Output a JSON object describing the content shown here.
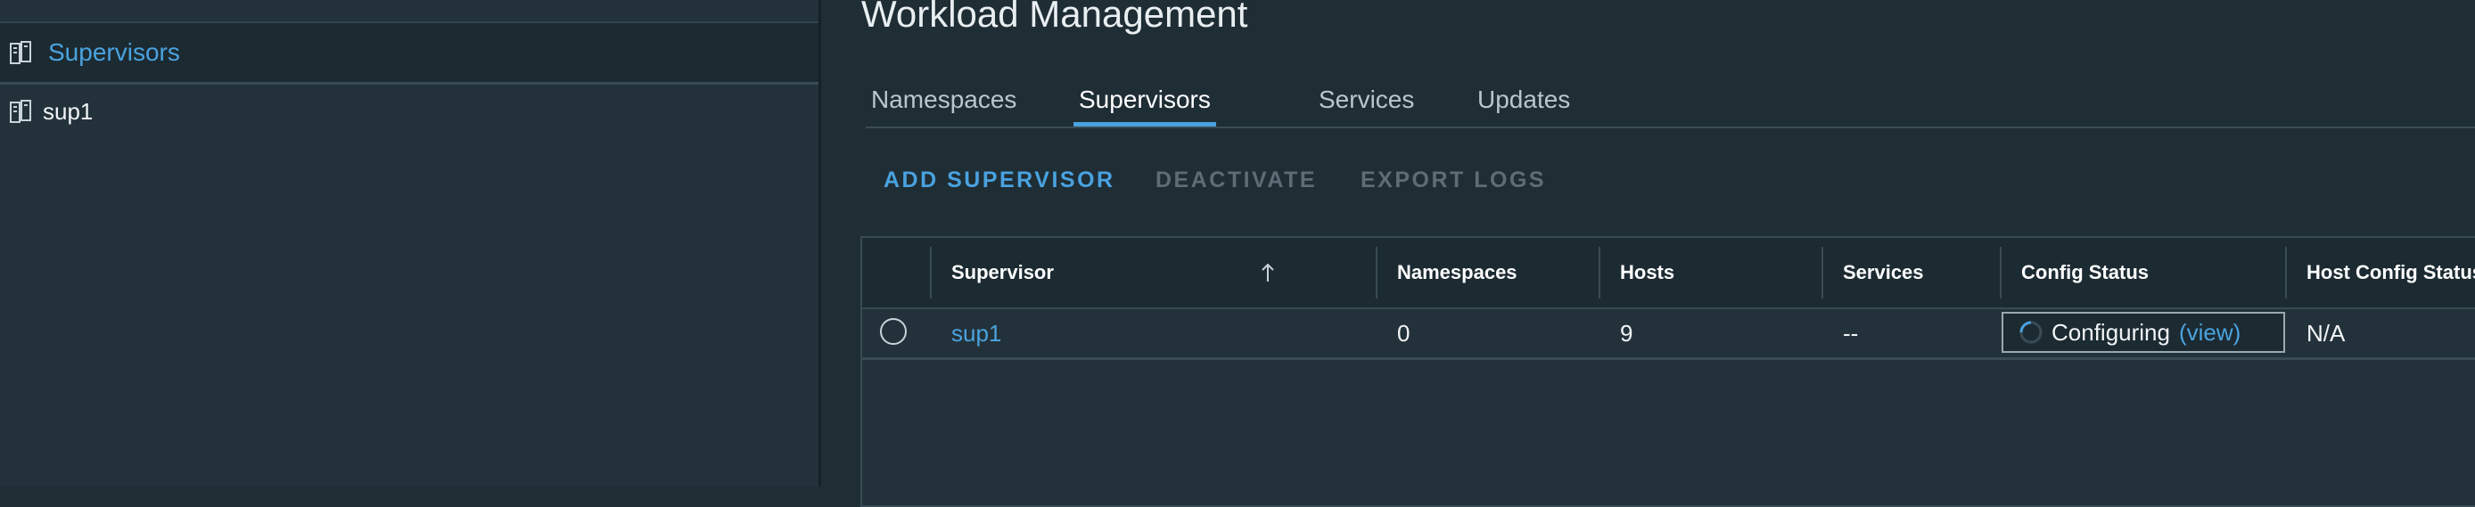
{
  "sidebar": {
    "header": {
      "label": "Supervisors",
      "icon": "supervisor-icon"
    },
    "items": [
      {
        "label": "sup1",
        "icon": "supervisor-icon"
      }
    ]
  },
  "page": {
    "title": "Workload Management"
  },
  "tabs": [
    {
      "label": "Namespaces",
      "active": false
    },
    {
      "label": "Supervisors",
      "active": true
    },
    {
      "label": "Services",
      "active": false
    },
    {
      "label": "Updates",
      "active": false
    }
  ],
  "actions": [
    {
      "label": "ADD SUPERVISOR",
      "enabled": true
    },
    {
      "label": "DEACTIVATE",
      "enabled": false
    },
    {
      "label": "EXPORT LOGS",
      "enabled": false
    }
  ],
  "table": {
    "columns": [
      "Supervisor",
      "Namespaces",
      "Hosts",
      "Services",
      "Config Status",
      "Host Config Status"
    ],
    "sort": {
      "column": "Supervisor",
      "direction": "ascending"
    },
    "rows": [
      {
        "supervisor": "sup1",
        "namespaces": "0",
        "hosts": "9",
        "services": "--",
        "config_status": "Configuring",
        "config_status_link": "(view)",
        "host_config_status": "N/A",
        "selected": false
      }
    ]
  },
  "colors": {
    "accent": "#49a2df",
    "background": "#1f2d35",
    "panel": "#23323a",
    "disabled": "#5e6d75"
  }
}
